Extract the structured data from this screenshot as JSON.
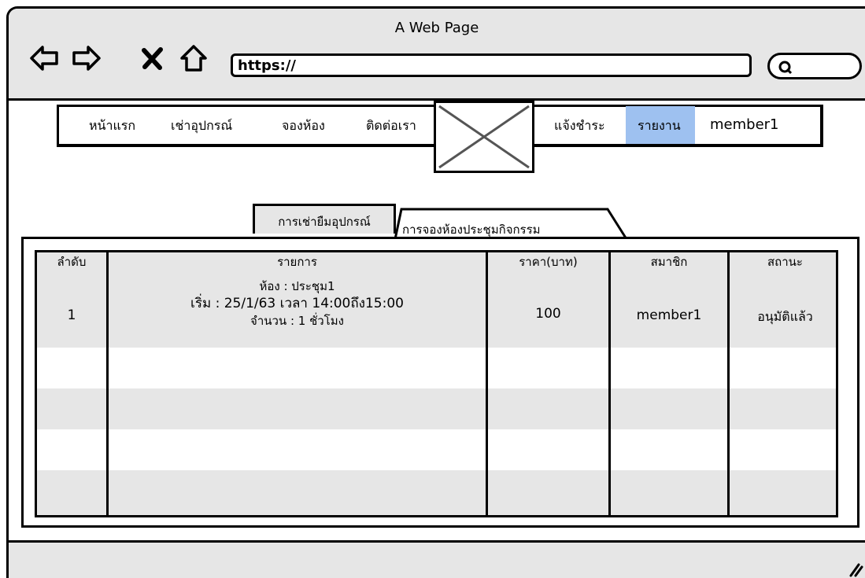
{
  "window": {
    "title": "A Web Page"
  },
  "address_bar": {
    "url": "https://"
  },
  "nav": {
    "items": [
      "หน้าแรก",
      "เช่าอุปกรณ์",
      "จองห้อง",
      "ติดต่อเรา",
      "แจ้งชำระ",
      "รายงาน",
      "member1"
    ],
    "active": "รายงาน"
  },
  "tabs": [
    {
      "label": "การเช่ายืมอุปกรณ์",
      "active": false
    },
    {
      "label": "การจองห้องประชุมกิจกรรม",
      "active": true
    }
  ],
  "table": {
    "headers": [
      "ลำดับ",
      "รายการ",
      "ราคา(บาท)",
      "สมาชิก",
      "สถานะ"
    ],
    "rows": [
      {
        "no": "1",
        "item_lines": [
          "ห้อง : ประชุม1",
          "เริ่ม : 25/1/63 เวลา 14:00ถึง15:00",
          "จำนวน : 1 ชั่วโมง"
        ],
        "price": "100",
        "member": "member1",
        "status": "อนุมัติแล้ว"
      }
    ]
  },
  "colors": {
    "chrome": "#e6e6e6",
    "active_menu": "#9ec1f0",
    "row_alt": "#e6e6e6"
  }
}
